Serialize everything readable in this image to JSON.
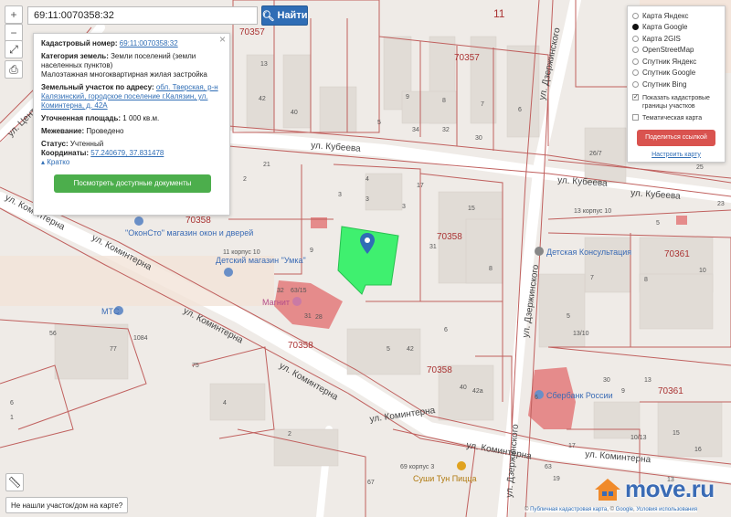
{
  "search": {
    "value": "69:11:0070358:32",
    "button_label": "Найти"
  },
  "info_panel": {
    "cadastral_number_label": "Кадастровый номер:",
    "cadastral_number": "69:11:0070358:32",
    "land_category_label": "Категория земель:",
    "land_category": "Земли поселений (земли населенных пунктов)",
    "permitted_use": "Малоэтажная многоквартирная жилая застройка",
    "address_label": "Земельный участок по адресу:",
    "address": "обл. Тверская, р-н Калязинский, городское поселение г.Калязин, ул. Коминтерна, д. 42А",
    "area_label": "Уточненная площадь:",
    "area": "1 000 кв.м.",
    "survey_label": "Межевание:",
    "survey": "Проведено",
    "status_label": "Статус:",
    "status": "Учтенный",
    "coords_label": "Координаты:",
    "coords": "57.240679, 37.831478",
    "collapse_label": "Кратко",
    "docs_button": "Посмотреть доступные документы"
  },
  "layers": {
    "options": [
      "Карта Яндекс",
      "Карта Google",
      "Карта 2GIS",
      "OpenStreetMap",
      "Спутник Яндекс",
      "Спутник Google",
      "Спутник Bing"
    ],
    "selected": "Карта Google",
    "cadastral_borders": "Показать кадастровые границы участков",
    "thematic": "Тематическая карта",
    "share_button": "Поделиться ссылкой",
    "configure_link": "Настроить карту"
  },
  "not_found_button": "Не нашли участок/дом на карте?",
  "attribution": {
    "pkk": "Публичная кадастровая карта",
    "google": "Google",
    "terms": "Условия использования"
  },
  "logo": "move.ru",
  "streets": {
    "kubeeva": "ул. Кубеева",
    "kominterna": "ул. Коминтерна",
    "dzerzhinskogo": "ул. Дзержинского",
    "tsentr": "ул. Цент"
  },
  "blocks": [
    "70357",
    "70358",
    "70361",
    "11"
  ],
  "pois": {
    "okonsto": "\"ОконСто\" магазин окон и дверей",
    "umka": "Детский магазин \"Умка\"",
    "clinic": "Детская Консультация",
    "sberbank": "Сбербанк России",
    "pizza": "Суши Тун Пицца",
    "mts": "МТС",
    "magnit": "Магнит"
  },
  "house_numbers": [
    "13",
    "42",
    "40",
    "9",
    "8",
    "7",
    "6",
    "5",
    "34",
    "32",
    "30",
    "3",
    "2",
    "26/7",
    "25",
    "23",
    "21",
    "3",
    "3",
    "4",
    "17",
    "15",
    "13 корпус 10",
    "11 корпус 10",
    "9",
    "31",
    "5",
    "7",
    "10",
    "8",
    "6",
    "5",
    "4",
    "1084",
    "75",
    "56",
    "77",
    "5",
    "42",
    "42а",
    "40",
    "6",
    "1",
    "2",
    "69 корпус 3",
    "67",
    "63",
    "13",
    "63/15",
    "31",
    "32",
    "28",
    "30",
    "6",
    "10/13",
    "15",
    "19",
    "17",
    "16",
    "8",
    "13/10",
    "9",
    "13",
    "5"
  ],
  "parcel_colors": {
    "selected": "#3ff06f",
    "commercial": "#e58b8b",
    "lines": "#c0605e"
  }
}
